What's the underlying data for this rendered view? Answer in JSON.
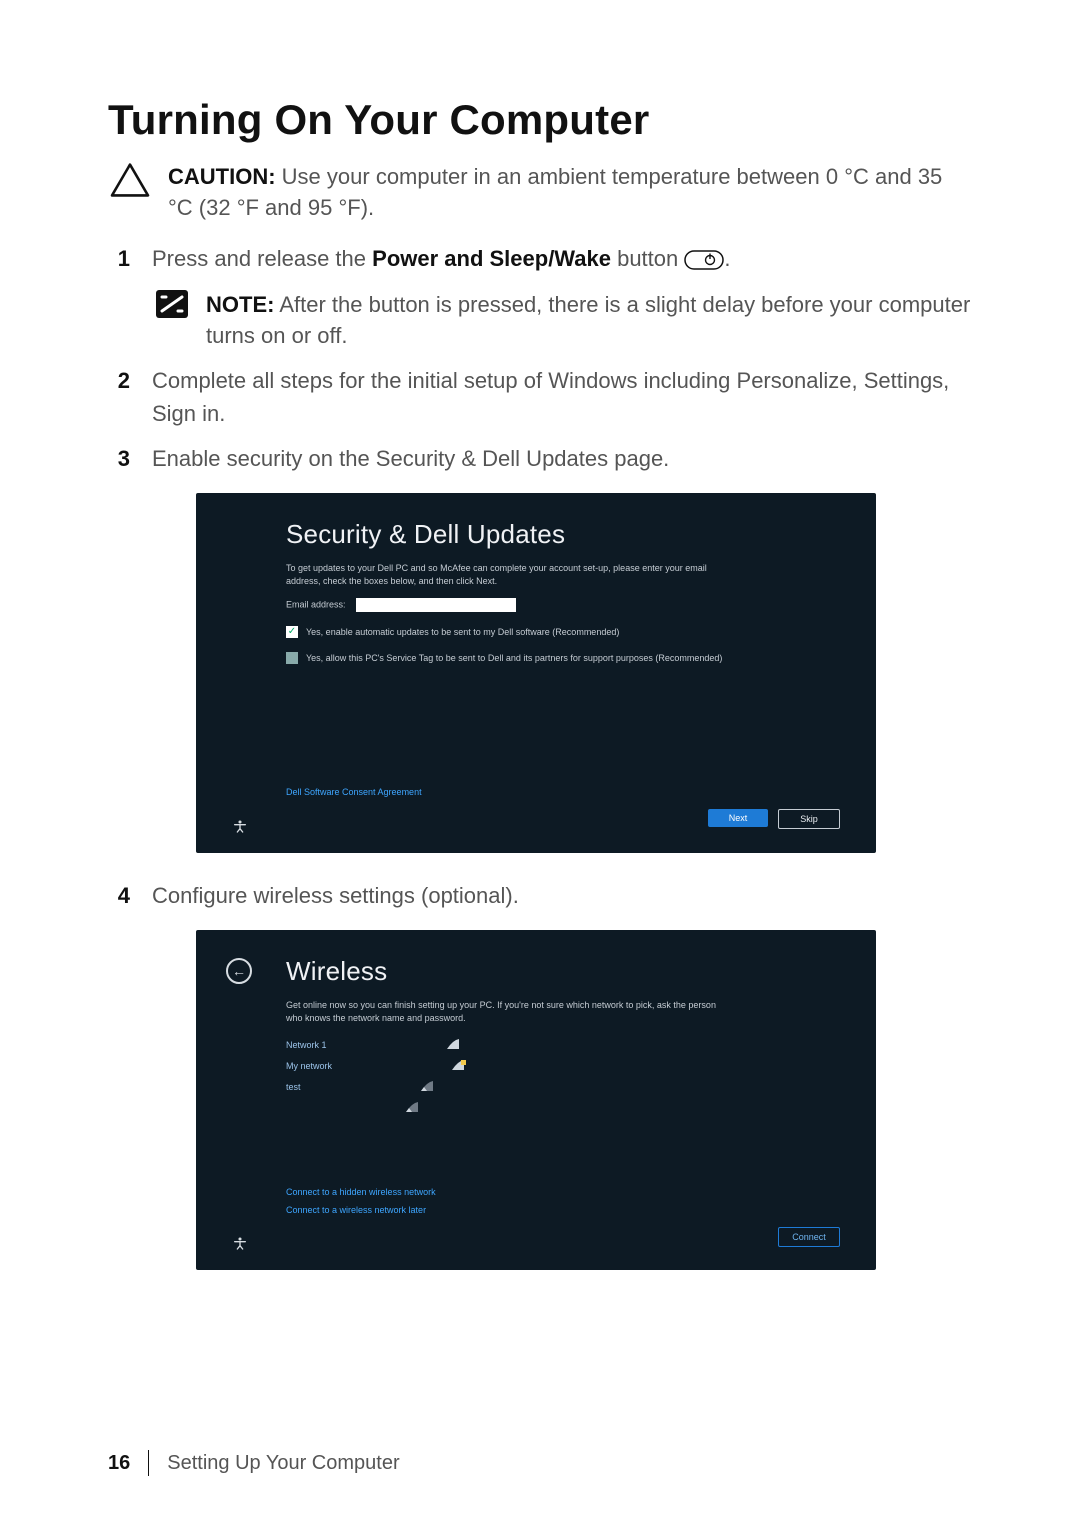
{
  "title": "Turning On Your Computer",
  "caution": {
    "label": "CAUTION:",
    "text": "Use your computer in an ambient temperature between 0 °C and 35 °C (32 °F and 95 °F)."
  },
  "steps": {
    "s1_pre": "Press and release the ",
    "s1_bold": "Power and Sleep/Wake",
    "s1_post": " button ",
    "s1_end": ".",
    "note_label": "NOTE:",
    "note_text": "After the button is pressed, there is a slight delay before your computer turns on or off.",
    "s2": "Complete all steps for the initial setup of Windows including Personalize, Settings, Sign in.",
    "s3": "Enable security on the Security & Dell Updates page.",
    "s4": "Configure wireless settings (optional)."
  },
  "nums": {
    "n1": "1",
    "n2": "2",
    "n3": "3",
    "n4": "4"
  },
  "security": {
    "title": "Security & Dell Updates",
    "desc": "To get updates to your Dell PC and so McAfee can complete your account set-up, please enter your email address, check the boxes below, and then click Next.",
    "email_label": "Email address:",
    "chk1": "Yes, enable automatic updates to be sent to my Dell software (Recommended)",
    "chk2": "Yes, allow this PC's Service Tag to be sent to Dell and its partners for support purposes (Recommended)",
    "agreement": "Dell Software Consent Agreement",
    "next": "Next",
    "skip": "Skip"
  },
  "wireless": {
    "title": "Wireless",
    "desc": "Get online now so you can finish setting up your PC. If you're not sure which network to pick, ask the person who knows the network name and password.",
    "net1": "Network 1",
    "net2": "My network",
    "net3": "test",
    "net4": "",
    "hidden": "Connect to a hidden wireless network",
    "later": "Connect to a wireless network later",
    "connect": "Connect"
  },
  "footer": {
    "page": "16",
    "section": "Setting Up Your Computer"
  }
}
